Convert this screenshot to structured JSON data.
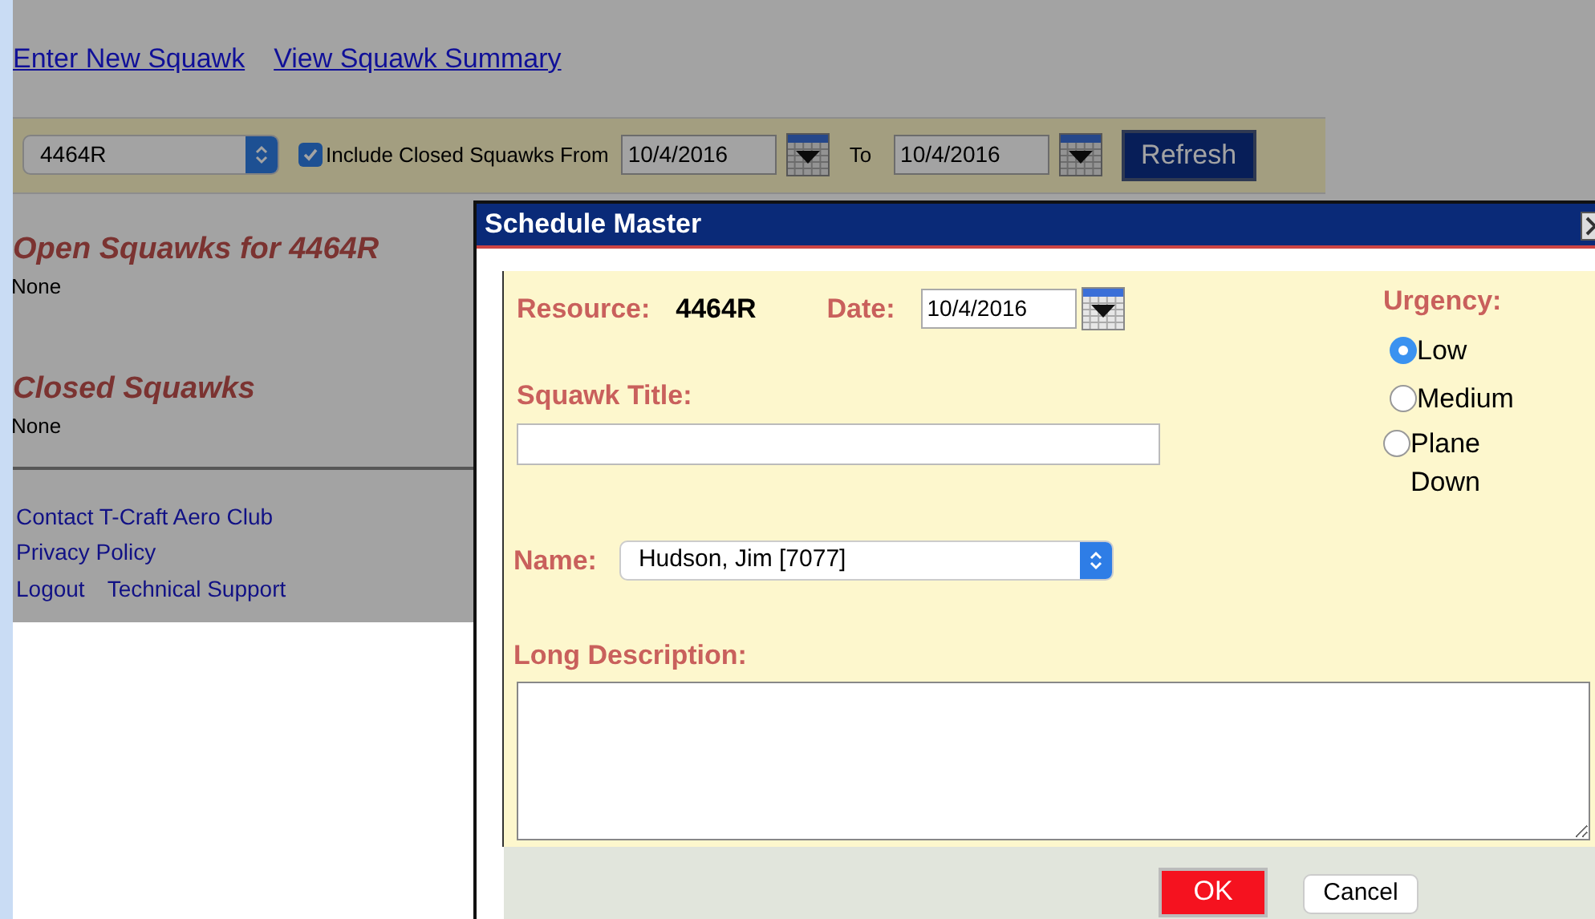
{
  "nav_links": [
    "Enter New Squawk",
    "View Squawk Summary"
  ],
  "toolbar": {
    "resource_select": "4464R",
    "include_closed": {
      "label": "Include Closed Squawks From",
      "checked": true
    },
    "from_date": "10/4/2016",
    "to_label": "To",
    "to_date": "10/4/2016",
    "refresh_button": "Refresh"
  },
  "sections": [
    {
      "heading": "Open Squawks for 4464R",
      "body": "None"
    },
    {
      "heading": "Closed Squawks",
      "body": "None"
    }
  ],
  "footer_links": [
    [
      "Contact T-Craft Aero Club"
    ],
    [
      "Privacy Policy"
    ],
    [
      "Logout",
      "Technical Support"
    ]
  ],
  "dialog": {
    "title": "Schedule Master",
    "resource_label": "Resource:",
    "resource_value": "4464R",
    "date_label": "Date:",
    "date_value": "10/4/2016",
    "squawk_title_label": "Squawk Title:",
    "urgency_label": "Urgency:",
    "urgency_options": [
      {
        "label": "Low",
        "selected": true
      },
      {
        "label": "Medium",
        "selected": false
      },
      {
        "label": "Plane Down",
        "selected": false
      }
    ],
    "name_label": "Name:",
    "name_value": "Hudson, Jim [7077]",
    "long_description_label": "Long Description:",
    "buttons": [
      {
        "label": "OK",
        "kind": "primary"
      },
      {
        "label": "Cancel",
        "kind": "secondary"
      }
    ]
  }
}
